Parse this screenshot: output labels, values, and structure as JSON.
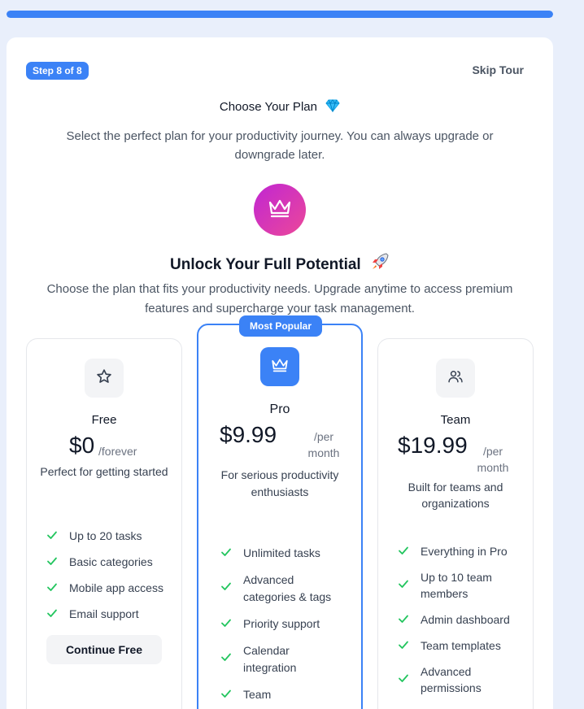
{
  "progress": {
    "fraction": 1.0
  },
  "tour": {
    "step_label": "Step 8 of 8",
    "skip_label": "Skip Tour",
    "choose_title": "Choose Your Plan",
    "choose_subtitle": "Select the perfect plan for your productivity journey. You can always upgrade or downgrade later.",
    "unlock_title": "Unlock Your Full Potential",
    "unlock_subtitle": "Choose the plan that fits your productivity needs. Upgrade anytime to access premium features and supercharge your task management."
  },
  "icons": {
    "gem": "gem-icon",
    "rocket": "rocket-icon",
    "crown": "crown-icon",
    "star": "star-icon",
    "users": "users-icon",
    "check": "check-icon"
  },
  "colors": {
    "accent": "#3b82f6",
    "check": "#22c55e",
    "crown_gradient_start": "#c026d3",
    "crown_gradient_end": "#ec4899"
  },
  "plans": [
    {
      "name": "Free",
      "price": "$0",
      "period": "/forever",
      "description": "Perfect for getting started",
      "features": [
        "Up to 20 tasks",
        "Basic categories",
        "Mobile app access",
        "Email support"
      ],
      "button": "Continue Free"
    },
    {
      "badge": "Most Popular",
      "name": "Pro",
      "price": "$9.99",
      "period": "/per month",
      "description": "For serious productivity enthusiasts",
      "features": [
        "Unlimited tasks",
        "Advanced categories & tags",
        "Priority support",
        "Calendar integration",
        "Team"
      ]
    },
    {
      "name": "Team",
      "price": "$19.99",
      "period": "/per month",
      "description": "Built for teams and organizations",
      "features": [
        "Everything in Pro",
        "Up to 10 team members",
        "Admin dashboard",
        "Team templates",
        "Advanced permissions"
      ]
    }
  ]
}
